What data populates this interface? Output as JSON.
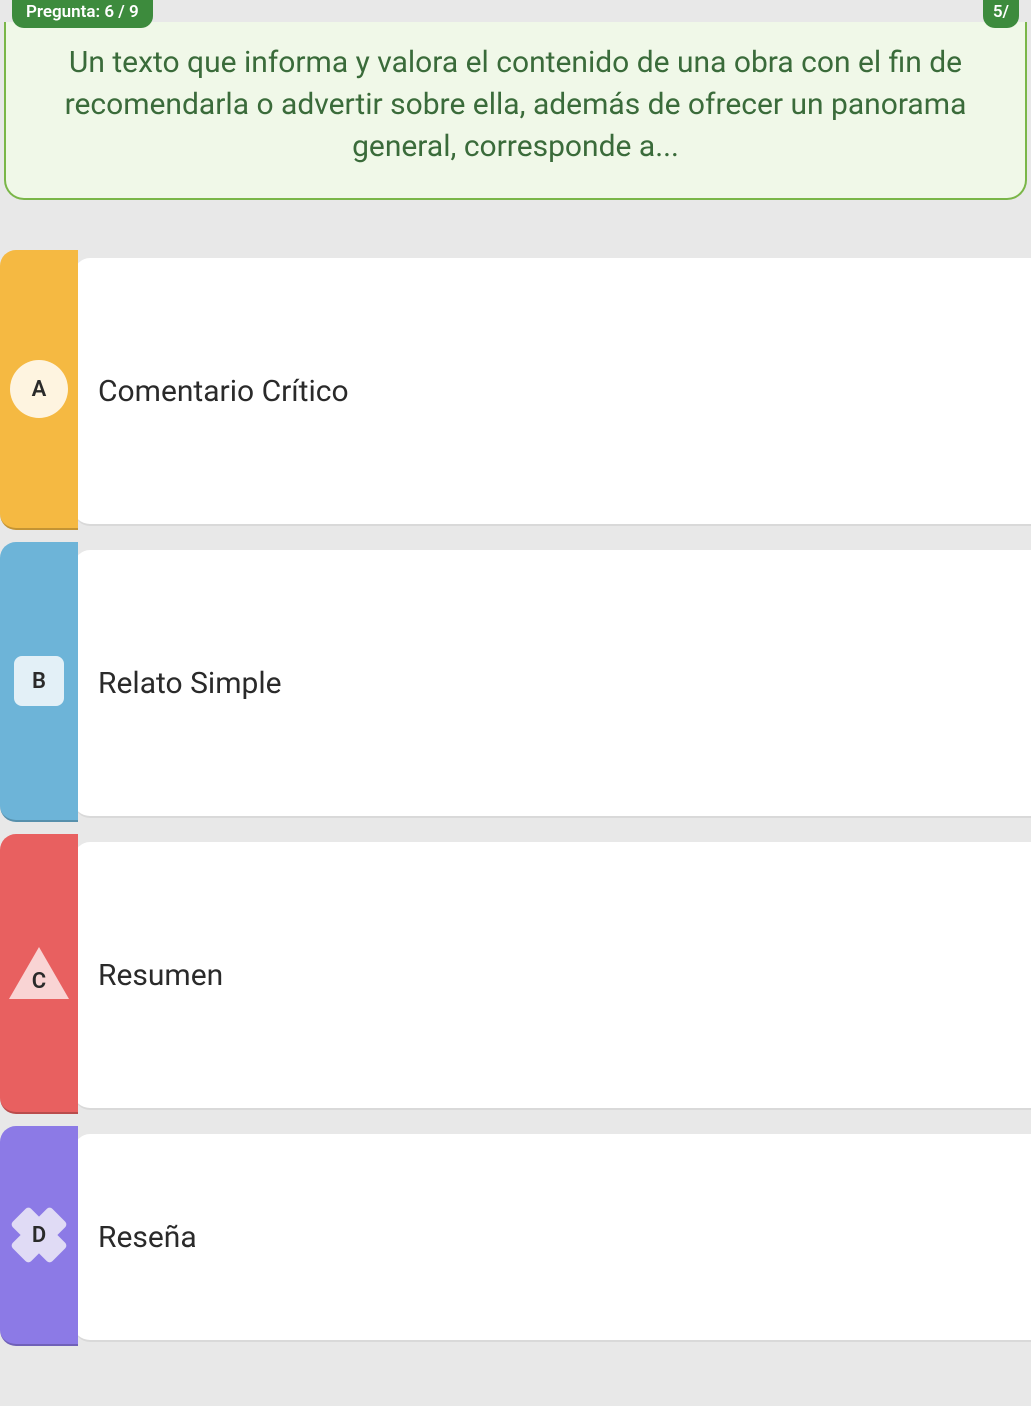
{
  "header": {
    "question_label": "Pregunta: 6 / 9",
    "score_label": "5/"
  },
  "question": {
    "text": "Un texto que informa y valora el contenido de una obra con el fin de recomendarla o advertir sobre ella, además de ofrecer un panorama general, corresponde a..."
  },
  "answers": {
    "a": {
      "letter": "A",
      "text": "Comentario Crítico"
    },
    "b": {
      "letter": "B",
      "text": "Relato Simple"
    },
    "c": {
      "letter": "C",
      "text": "Resumen"
    },
    "d": {
      "letter": "D",
      "text": "Reseña"
    }
  }
}
